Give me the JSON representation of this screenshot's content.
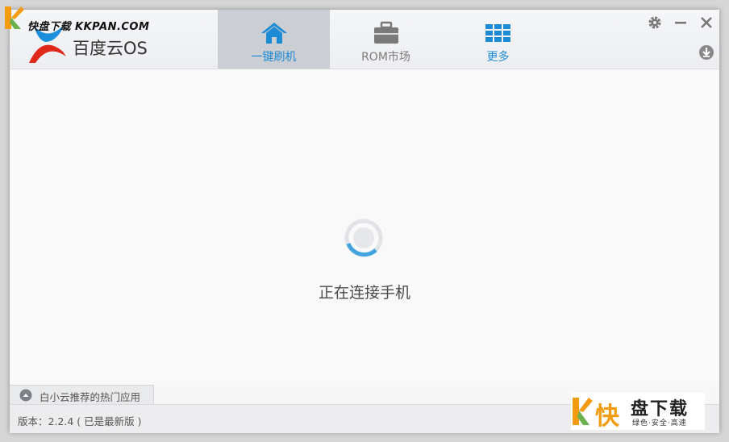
{
  "window": {
    "brand": "百度云OS",
    "colors": {
      "accent": "#1d8ad6",
      "active_tab_bg": "#cbced3",
      "logo_blue": "#1a8fdc",
      "logo_red": "#e0281b"
    }
  },
  "tabs": [
    {
      "label": "一键刷机",
      "icon": "home-icon",
      "active": true
    },
    {
      "label": "ROM市场",
      "icon": "briefcase-icon",
      "active": false
    },
    {
      "label": "更多",
      "icon": "grid-icon",
      "active": false
    }
  ],
  "controls": {
    "settings": "gear-icon",
    "minimize": "minimize-icon",
    "close": "close-icon",
    "download": "download-icon"
  },
  "main": {
    "status_text": "正在连接手机"
  },
  "recommend": {
    "label": "白小云推荐的热门应用",
    "icon": "chevron-up-icon"
  },
  "footer": {
    "version_text": "版本：2.2.4 ( 已是最新版 )"
  },
  "watermark": {
    "top_text": "快盘下载 KKPAN.COM",
    "bottom_title": "快盘下载",
    "bottom_tagline": "绿色·安全·高速"
  }
}
